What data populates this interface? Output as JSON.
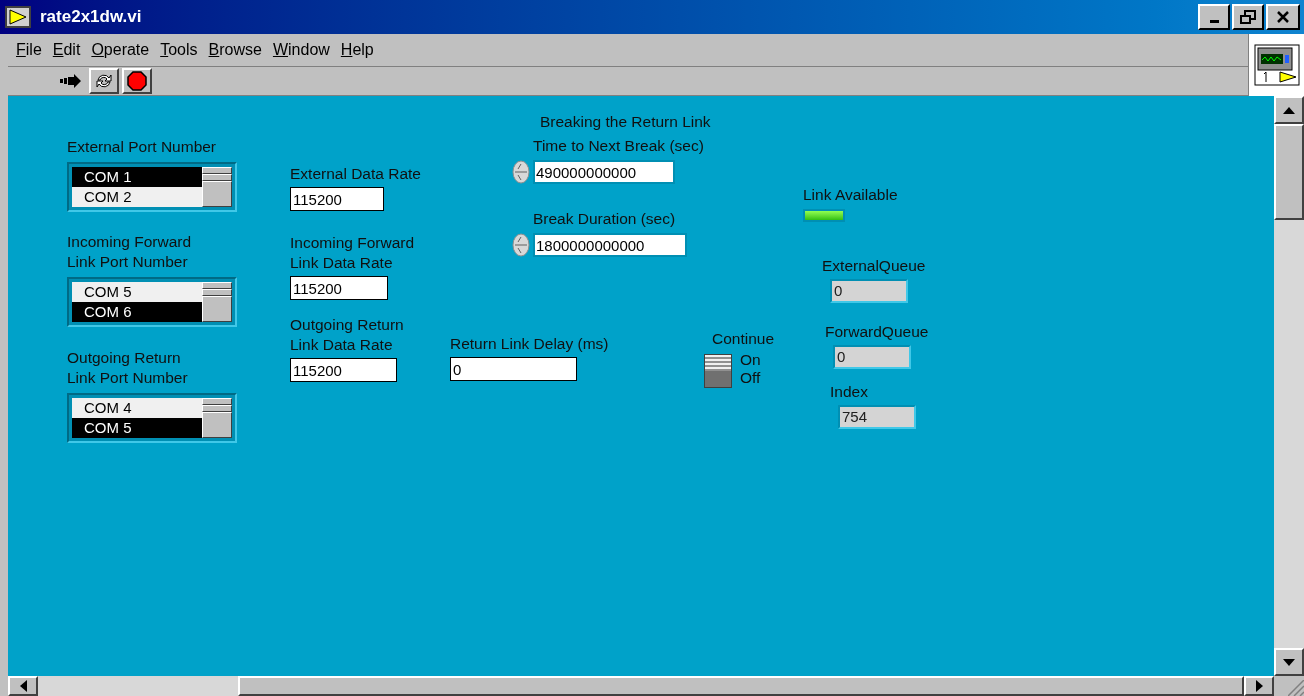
{
  "window": {
    "title": "rate2x1dw.vi"
  },
  "menu": [
    "File",
    "Edit",
    "Operate",
    "Tools",
    "Browse",
    "Window",
    "Help"
  ],
  "panel": {
    "controls": [
      {
        "kind": "ring",
        "label": "External Port Number",
        "options": [
          {
            "label": "COM 1",
            "selected": true
          },
          {
            "label": "COM 2",
            "selected": false
          }
        ]
      },
      {
        "kind": "ring",
        "label": "Incoming Forward\nLink Port Number",
        "options": [
          {
            "label": "COM 5",
            "selected": false
          },
          {
            "label": "COM 6",
            "selected": true
          }
        ]
      },
      {
        "kind": "ring",
        "label": "Outgoing Return\nLink Port Number",
        "options": [
          {
            "label": "COM 4",
            "selected": false
          },
          {
            "label": "COM 5",
            "selected": true
          }
        ]
      },
      {
        "kind": "numeric",
        "label": "External Data Rate",
        "value": "115200"
      },
      {
        "kind": "numeric",
        "label": "Incoming Forward\nLink Data Rate",
        "value": "115200"
      },
      {
        "kind": "numeric",
        "label": "Outgoing Return\nLink Data Rate",
        "value": "115200"
      },
      {
        "kind": "numeric",
        "label": "Return Link Delay (ms)",
        "value": "0"
      },
      {
        "kind": "caption",
        "label": "Breaking the Return Link"
      },
      {
        "kind": "stepper",
        "label": "Time to Next Break (sec)",
        "value": "490000000000"
      },
      {
        "kind": "stepper",
        "label": "Break Duration (sec)",
        "value": "1800000000000"
      },
      {
        "kind": "led",
        "label": "Link Available",
        "on": true
      },
      {
        "kind": "indicator",
        "label": "ExternalQueue",
        "value": "0"
      },
      {
        "kind": "indicator",
        "label": "ForwardQueue",
        "value": "0"
      },
      {
        "kind": "indicator",
        "label": "Index",
        "value": "754"
      },
      {
        "kind": "switch",
        "label": "Continue",
        "on": true,
        "on_text": "On",
        "off_text": "Off"
      }
    ]
  }
}
